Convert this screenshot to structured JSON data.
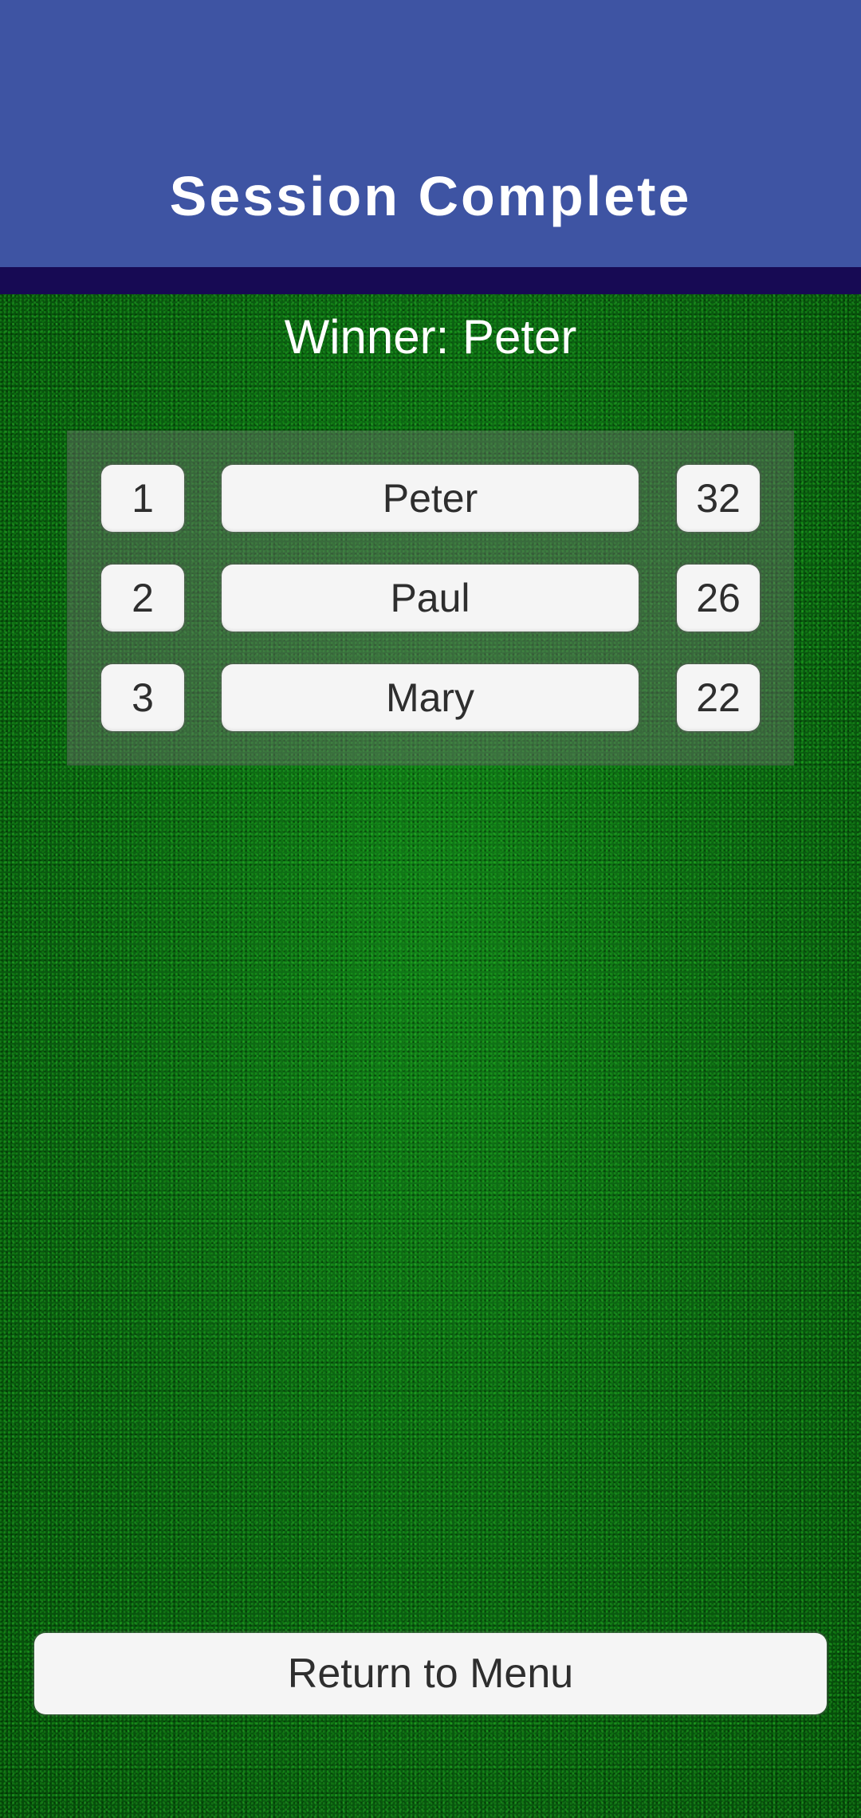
{
  "header": {
    "title": "Session Complete"
  },
  "winner": {
    "label": "Winner: Peter"
  },
  "results": [
    {
      "rank": "1",
      "name": "Peter",
      "score": "32"
    },
    {
      "rank": "2",
      "name": "Paul",
      "score": "26"
    },
    {
      "rank": "3",
      "name": "Mary",
      "score": "22"
    }
  ],
  "actions": {
    "return_label": "Return to Menu"
  },
  "colors": {
    "header_bg": "#3e54a3",
    "divider_bg": "#170a54",
    "background": "#0b5a12",
    "cell_bg": "#f5f5f5",
    "cell_text": "#2e2e2e"
  }
}
